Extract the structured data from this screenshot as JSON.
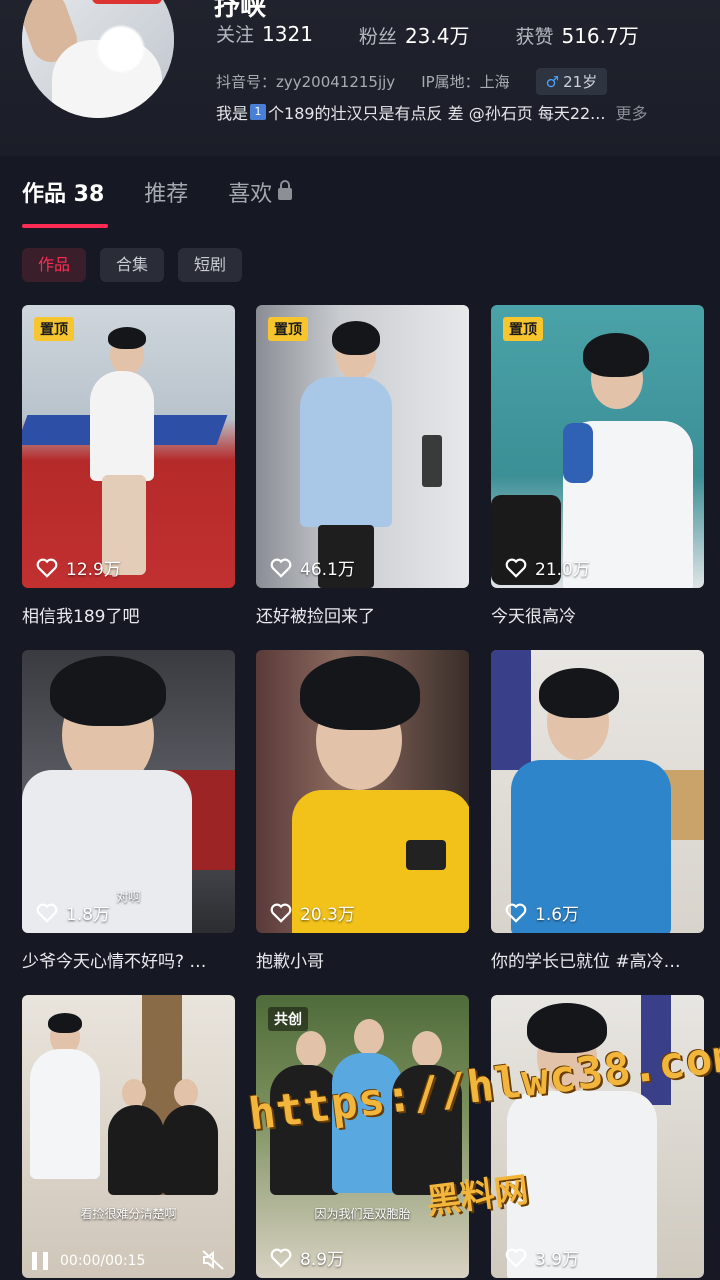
{
  "profile": {
    "name": "抒峡",
    "stats": [
      {
        "label": "关注",
        "value": "1321"
      },
      {
        "label": "粉丝",
        "value": "23.4万"
      },
      {
        "label": "获赞",
        "value": "516.7万"
      }
    ],
    "douyin_id": "抖音号：zyy20041215jjy",
    "ip": "IP属地：上海",
    "gender_age": "21岁",
    "bio_prefix": "我是",
    "bio_num": "1",
    "bio_suffix": "个189的壮汉只是有点反 差 @孙石页  每天22...",
    "bio_more": "更多"
  },
  "tabs": [
    {
      "label": "作品 38",
      "active": true
    },
    {
      "label": "推荐",
      "active": false
    },
    {
      "label": "喜欢",
      "active": false
    }
  ],
  "chips": [
    "作品",
    "合集",
    "短剧"
  ],
  "videos": [
    {
      "badge": "置顶",
      "likes": "12.9万",
      "caption": "相信我189了吧"
    },
    {
      "badge": "置顶",
      "likes": "46.1万",
      "caption": "还好被捡回来了"
    },
    {
      "badge": "置顶",
      "likes": "21.0万",
      "caption": "今天很高冷"
    },
    {
      "badge": "",
      "likes": "1.8万",
      "caption": "少爷今天心情不好吗? …",
      "inner": "对啊"
    },
    {
      "badge": "",
      "likes": "20.3万",
      "caption": "抱歉小哥"
    },
    {
      "badge": "",
      "likes": "1.6万",
      "caption": "你的学长已就位 #高冷…"
    },
    {
      "badge": "",
      "inner": "看捡很难分清楚啊",
      "time": "00:00/00:15"
    },
    {
      "badge": "共创",
      "likes": "8.9万",
      "inner": "因为我们是双胞胎"
    },
    {
      "badge": "",
      "likes": "3.9万"
    }
  ],
  "watermark": {
    "url": "https://hlwc38.com",
    "name": "黑料网"
  },
  "colors": {
    "accent": "#fe2c55",
    "pin": "#f7c62f",
    "bg": "#161823"
  }
}
